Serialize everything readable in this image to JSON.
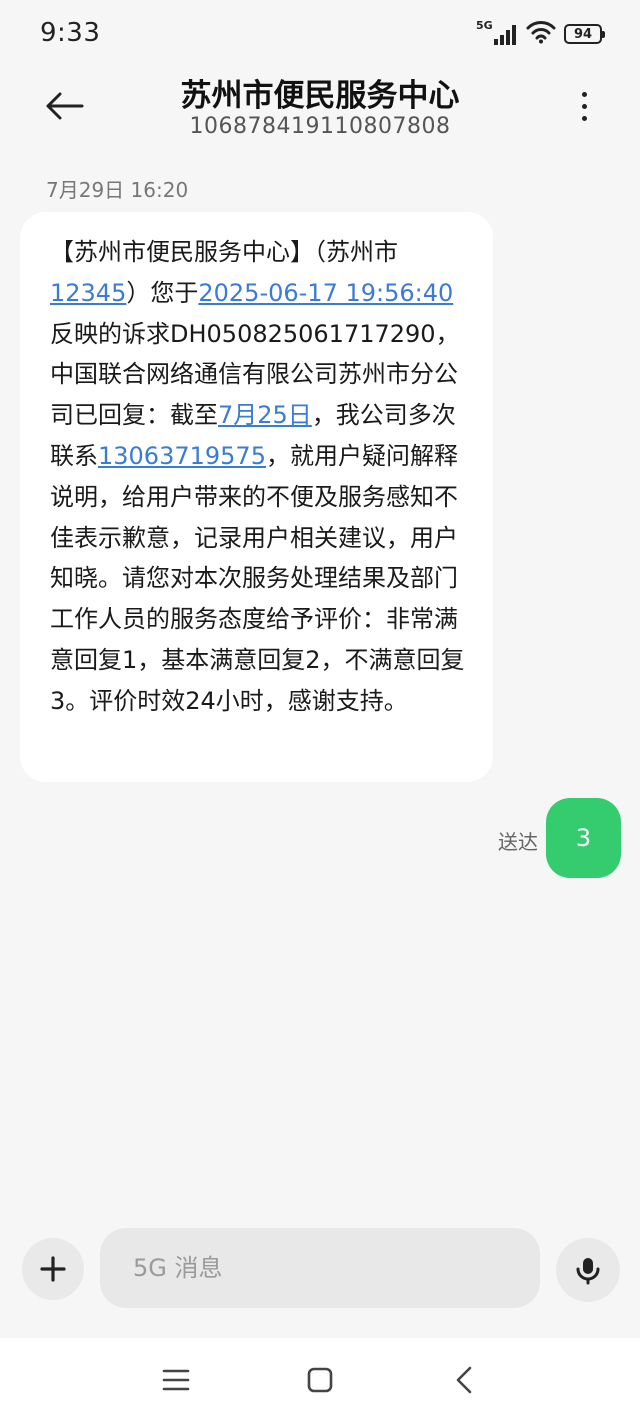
{
  "status_bar": {
    "time": "9:33",
    "network": "5G",
    "battery": "94"
  },
  "header": {
    "title": "苏州市便民服务中心",
    "subtitle": "106878419110807808"
  },
  "conversation": {
    "date": "7月29日 16:20",
    "incoming_message": {
      "segments": [
        {
          "text": "【苏州市便民服务中心】（苏州市",
          "link": false
        },
        {
          "text": "12345",
          "link": true
        },
        {
          "text": "）您于",
          "link": false
        },
        {
          "text": "2025-06-17 19:56:40",
          "link": true
        },
        {
          "text": "反映的诉求DH050825061717290，中国联合网络通信有限公司苏州市分公司已回复：截至",
          "link": false
        },
        {
          "text": "7月25日",
          "link": true
        },
        {
          "text": "，我公司多次联系",
          "link": false
        },
        {
          "text": "13063719575",
          "link": true
        },
        {
          "text": "，就用户疑问解释说明，给用户带来的不便及服务感知不佳表示歉意，记录用户相关建议，用户知晓。请您对本次服务处理结果及部门工作人员的服务态度给予评价：非常满意回复1，基本满意回复2，不满意回复3。评价时效24小时，感谢支持。",
          "link": false
        }
      ]
    },
    "outgoing_message": {
      "text": "3",
      "status": "送达"
    }
  },
  "composer": {
    "placeholder": "5G 消息"
  },
  "colors": {
    "background": "#f6f6f6",
    "incoming_bubble": "#ffffff",
    "outgoing_bubble": "#34cc6f",
    "link": "#3a7bd5"
  },
  "icons": {
    "back": "back-arrow-icon",
    "more": "more-vertical-icon",
    "plus": "plus-icon",
    "mic": "mic-icon",
    "nav_menu": "menu-icon",
    "nav_home": "home-icon",
    "nav_back": "back-chevron-icon"
  }
}
